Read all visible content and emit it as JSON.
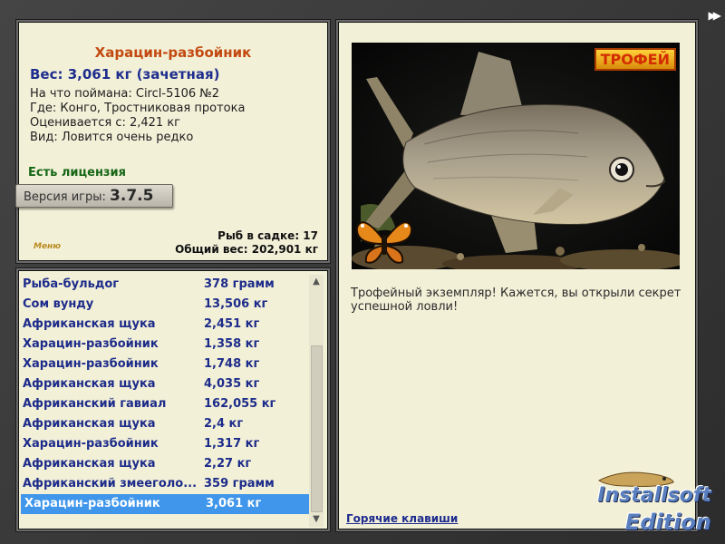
{
  "fish": {
    "title": "Харацин-разбойник",
    "weight_line": "Вес: 3,061 кг (зачетная)",
    "bait_line": "На что поймана: Circl-5106 №2",
    "place_line": "Где: Конго, Тростниковая протока",
    "price_line": "Оценивается с: 2,421 кг",
    "kind_line": "Вид: Ловится очень редко"
  },
  "license": "Есть лицензия",
  "version": {
    "label": "Версия игры:",
    "value": "3.7.5"
  },
  "menu_label": "Меню",
  "stats": {
    "keepnet": "Рыб в садке: 17",
    "total_weight": "Общий вес: 202,901 кг"
  },
  "catch_list": [
    {
      "name": "Рыба-бульдог",
      "weight": "378 грамм"
    },
    {
      "name": "Сом вунду",
      "weight": "13,506 кг"
    },
    {
      "name": "Африканская щука",
      "weight": "2,451 кг"
    },
    {
      "name": "Харацин-разбойник",
      "weight": "1,358 кг"
    },
    {
      "name": "Харацин-разбойник",
      "weight": "1,748 кг"
    },
    {
      "name": "Африканская щука",
      "weight": "4,035 кг"
    },
    {
      "name": "Африканский гавиал",
      "weight": "162,055 кг"
    },
    {
      "name": "Африканская щука",
      "weight": "2,4 кг"
    },
    {
      "name": "Харацин-разбойник",
      "weight": "1,317 кг"
    },
    {
      "name": "Африканская щука",
      "weight": "2,27 кг"
    },
    {
      "name": "Африканский змееголо...",
      "weight": "359 грамм"
    },
    {
      "name": "Харацин-разбойник",
      "weight": "3,061 кг",
      "selected": true
    }
  ],
  "trophy": {
    "badge": "ТРОФЕЙ",
    "text": "Трофейный экземпляр! Кажется, вы открыли секрет успешной ловли!"
  },
  "hotkeys_link": "Горячие клавиши",
  "logo": {
    "line1": "Installsoft",
    "line2": "Edition"
  },
  "colors": {
    "panel_bg": "#f3f0d8",
    "title": "#c24a10",
    "list_text": "#1d2c8a",
    "selection": "#3f96ea",
    "license": "#156615"
  },
  "icons": {
    "forward": "double-chevron-right-icon",
    "scroll_up": "chevron-up-icon",
    "scroll_down": "chevron-down-icon"
  }
}
